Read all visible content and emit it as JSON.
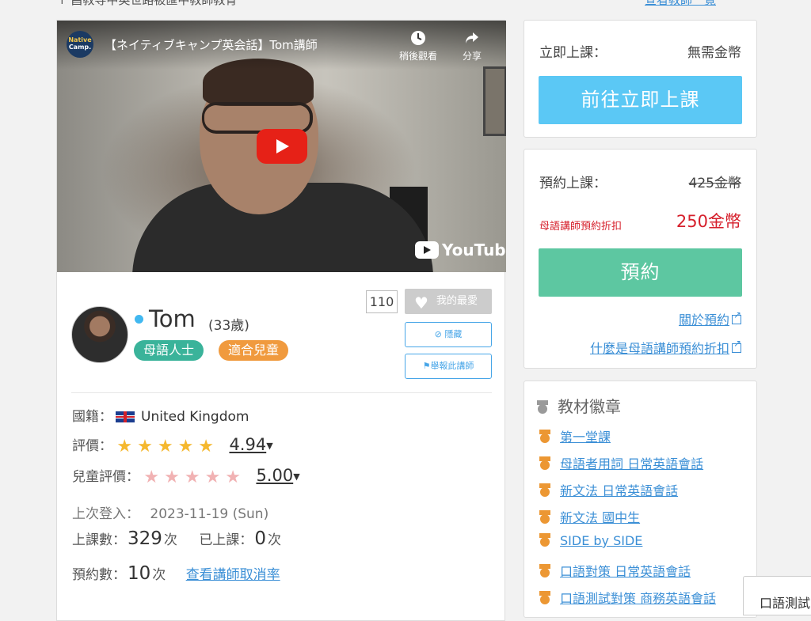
{
  "top_cut": {
    "left_text": "↑ 昌教导中英世路被匯中教師教育",
    "right_text": "查看教師一覧"
  },
  "video": {
    "channel_logo_line1": "Native",
    "channel_logo_line2": "Camp.",
    "title": "【ネイティブキャンプ英会話】Tom講師",
    "watch_later": "稍後觀看",
    "share": "分享",
    "brand": "YouTube"
  },
  "profile": {
    "name": "Tom",
    "age": "(33歲)",
    "tags": [
      "母語人士",
      "適合兒童"
    ],
    "fav_count": "110",
    "fav_label": "我的最愛",
    "hide_label": "隱藏",
    "report_label": "舉報此講師",
    "nationality_label": "國籍：",
    "nationality": "United Kingdom",
    "rating_label": "評價：",
    "rating": "4.94",
    "rating_stars": 5,
    "kids_rating_label": "兒童評價：",
    "kids_rating": "5.00",
    "last_login_label": "上次登入：",
    "last_login": "2023-11-19 (Sun)",
    "lessons_label": "上課數：",
    "lessons": "329",
    "times_unit": "次",
    "taken_label": "已上課：",
    "taken": "0",
    "reservations_label": "預約數：",
    "reservations": "10",
    "cancel_rate_link": "查看講師取消率"
  },
  "instant": {
    "label": "立即上課：",
    "value": "無需金幣",
    "button": "前往立即上課"
  },
  "reserve": {
    "label": "預約上課：",
    "original_price": "425金幣",
    "discount_label": "母語講師預約折扣",
    "discount_price": "250金幣",
    "button": "預約",
    "about_link": "關於預約",
    "discount_link": "什麼是母語講師預約折扣"
  },
  "badges": {
    "title": "教材徽章",
    "items": [
      "第一堂課",
      "母語者用詞 日常英語會話",
      "新文法 日常英語會話",
      "新文法 國中生",
      "SIDE by SIDE",
      "口語對策 日常英語會話",
      "口語測試對策 商務英語會話"
    ]
  },
  "corner": {
    "text": "口語測試"
  },
  "colors": {
    "accent_blue": "#5bc8f5",
    "accent_green": "#5dc7a1",
    "discount_red": "#d6202c",
    "link_blue": "#3b8fd6",
    "star_gold": "#f5b82e",
    "star_pink": "#f1b2b3"
  }
}
